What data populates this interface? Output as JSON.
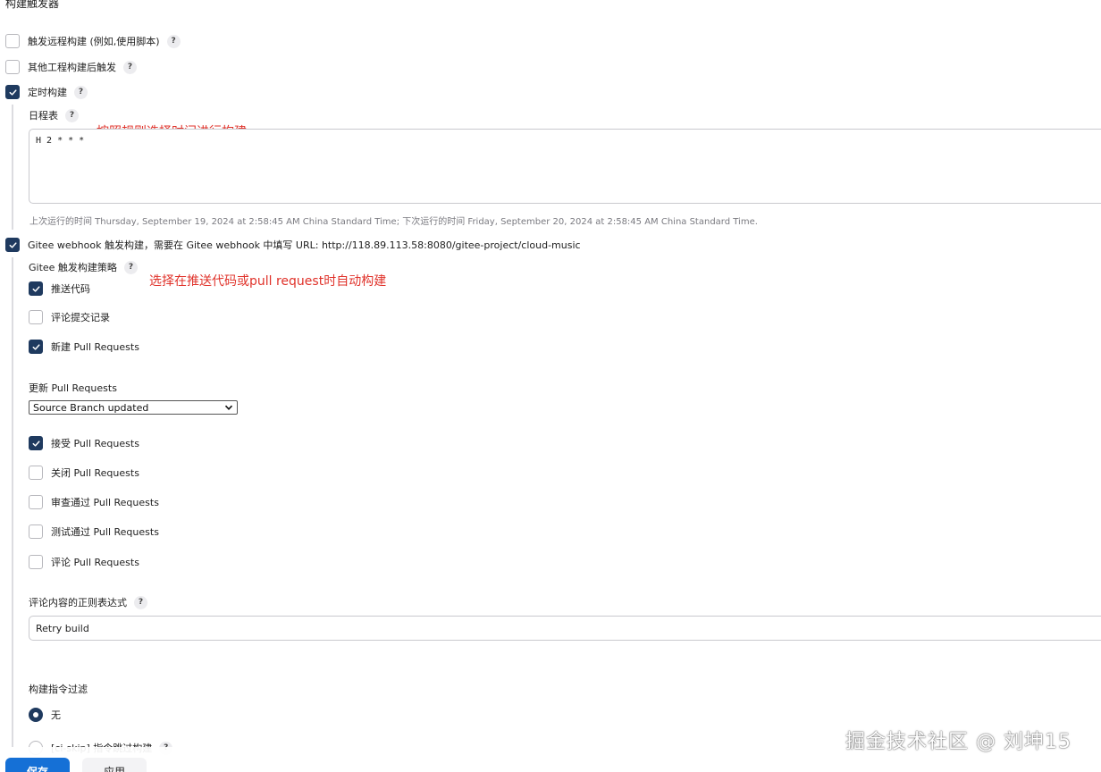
{
  "section_title": "构建触发器",
  "triggers": {
    "remote": {
      "label": "触发远程构建 (例如,使用脚本)",
      "checked": false
    },
    "after_other": {
      "label": "其他工程构建后触发",
      "checked": false
    },
    "periodic": {
      "label": "定时构建",
      "checked": true
    },
    "gitee": {
      "label": "Gitee webhook 触发构建，需要在 Gitee webhook 中填写 URL: http://118.89.113.58:8080/gitee-project/cloud-music",
      "checked": true
    }
  },
  "help_glyph": "?",
  "schedule": {
    "label": "日程表",
    "value": "H 2 * * *",
    "hint": "上次运行的时间 Thursday, September 19, 2024 at 2:58:45 AM China Standard Time; 下次运行的时间 Friday, September 20, 2024 at 2:58:45 AM China Standard Time."
  },
  "annotations": {
    "schedule_note": "按照规则选择时间进行构建",
    "strategy_note": "选择在推送代码或pull request时自动构建"
  },
  "strategy": {
    "label": "Gitee 触发构建策略",
    "options": [
      {
        "label": "推送代码",
        "checked": true
      },
      {
        "label": "评论提交记录",
        "checked": false
      },
      {
        "label": "新建 Pull Requests",
        "checked": true
      }
    ],
    "update_label": "更新 Pull Requests",
    "update_selected": "Source Branch updated",
    "options2": [
      {
        "label": "接受 Pull Requests",
        "checked": true
      },
      {
        "label": "关闭 Pull Requests",
        "checked": false
      },
      {
        "label": "审查通过 Pull Requests",
        "checked": false
      },
      {
        "label": "测试通过 Pull Requests",
        "checked": false
      },
      {
        "label": "评论 Pull Requests",
        "checked": false
      }
    ],
    "regex_label": "评论内容的正则表达式",
    "regex_value": "Retry build"
  },
  "build_filter": {
    "label": "构建指令过滤",
    "options": [
      {
        "label": "无",
        "checked": true
      },
      {
        "label": "[ci-skip] 指令跳过构建",
        "checked": false
      }
    ]
  },
  "buttons": {
    "save": "保存",
    "apply": "应用"
  },
  "watermark": "掘金技术社区 @ 刘坤15",
  "colors": {
    "checked": "#1f3a5f",
    "primary": "#1570d6",
    "annotation": "#e0322a"
  }
}
